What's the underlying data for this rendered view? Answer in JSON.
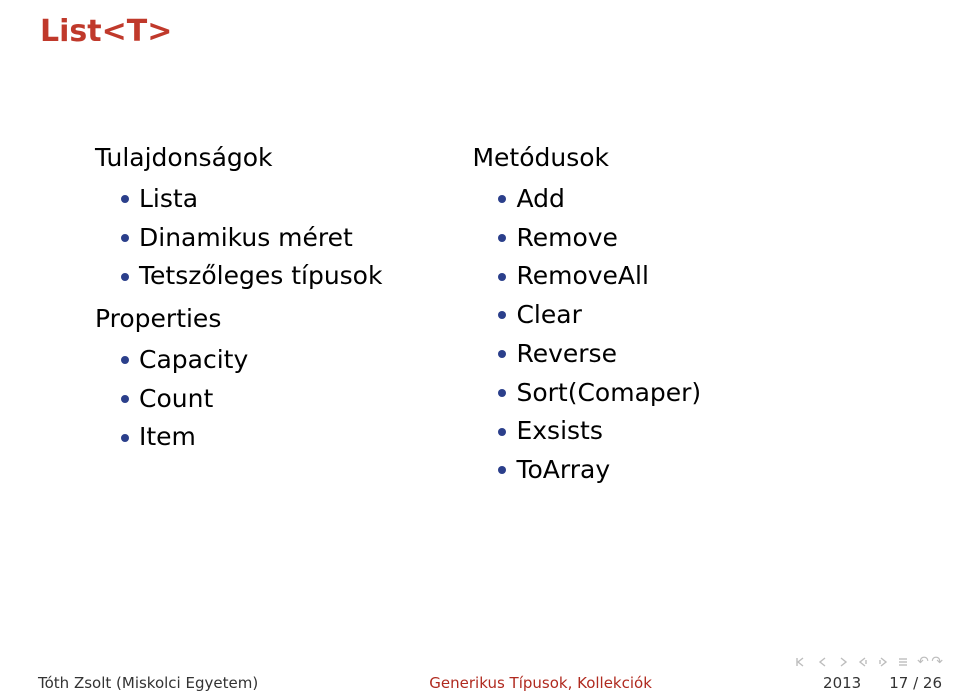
{
  "title": "List<T>",
  "left": {
    "heading1": "Tulajdonságok",
    "items1": [
      "Lista",
      "Dinamikus méret",
      "Tetszőleges típusok"
    ],
    "heading2": "Properties",
    "items2": [
      "Capacity",
      "Count",
      "Item"
    ]
  },
  "right": {
    "heading": "Metódusok",
    "items": [
      "Add",
      "Remove",
      "RemoveAll",
      "Clear",
      "Reverse",
      "Sort(Comaper)",
      "Exsists",
      "ToArray"
    ]
  },
  "footer": {
    "author": "Tóth Zsolt (Miskolci Egyetem)",
    "center": "Generikus Típusok, Kollekciók",
    "year": "2013",
    "page": "17 / 26"
  },
  "chart_data": {
    "type": "table",
    "title": "List<T>",
    "sections": [
      {
        "name": "Tulajdonságok",
        "values": [
          "Lista",
          "Dinamikus méret",
          "Tetszőleges típusok"
        ]
      },
      {
        "name": "Properties",
        "values": [
          "Capacity",
          "Count",
          "Item"
        ]
      },
      {
        "name": "Metódusok",
        "values": [
          "Add",
          "Remove",
          "RemoveAll",
          "Clear",
          "Reverse",
          "Sort(Comaper)",
          "Exsists",
          "ToArray"
        ]
      }
    ]
  }
}
